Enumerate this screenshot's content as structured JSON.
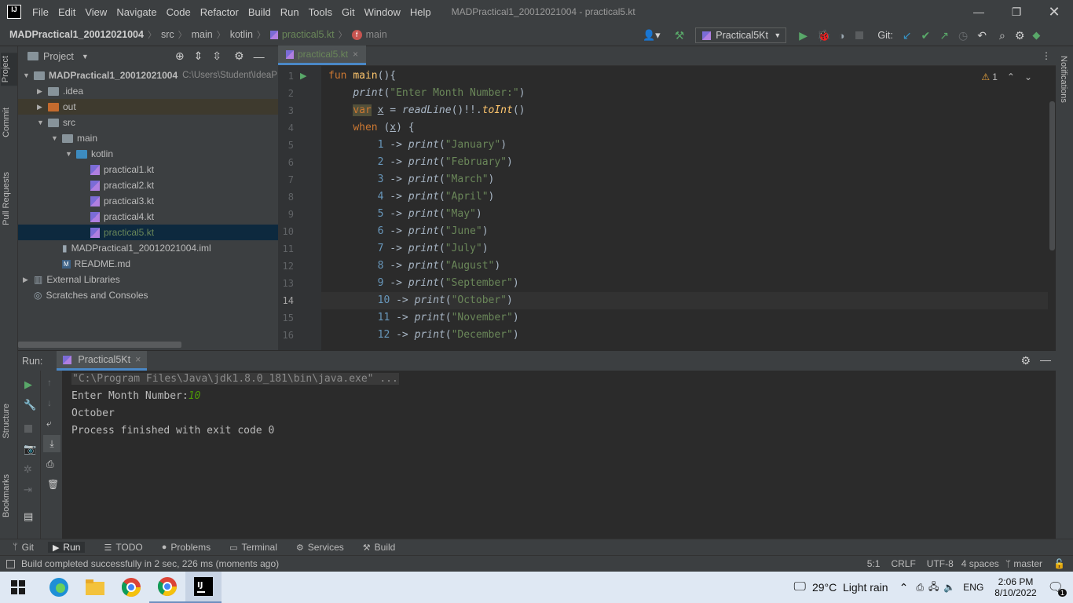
{
  "menubar": {
    "items": [
      "File",
      "Edit",
      "View",
      "Navigate",
      "Code",
      "Refactor",
      "Build",
      "Run",
      "Tools",
      "Git",
      "Window",
      "Help"
    ],
    "title": "MADPractical1_20012021004 - practical5.kt"
  },
  "navbar": {
    "crumbs": [
      "MADPractical1_20012021004",
      "src",
      "main",
      "kotlin",
      "practical5.kt",
      "main"
    ],
    "run_config": "Practical5Kt",
    "git_label": "Git:"
  },
  "side_tabs": {
    "left_top": [
      "Project",
      "Commit",
      "Pull Requests"
    ],
    "left_bottom": [
      "Structure",
      "Bookmarks"
    ],
    "right": [
      "Notifications"
    ]
  },
  "project": {
    "header": "Project",
    "tree": [
      {
        "label": "MADPractical1_20012021004",
        "path": "C:\\Users\\Student\\IdeaP",
        "indent": 0,
        "icon": "folder",
        "arrow": "down"
      },
      {
        "label": ".idea",
        "indent": 1,
        "icon": "folder",
        "arrow": "right"
      },
      {
        "label": "out",
        "indent": 1,
        "icon": "folder-orange",
        "arrow": "right"
      },
      {
        "label": "src",
        "indent": 1,
        "icon": "folder",
        "arrow": "down"
      },
      {
        "label": "main",
        "indent": 2,
        "icon": "folder",
        "arrow": "down"
      },
      {
        "label": "kotlin",
        "indent": 3,
        "icon": "folder-blue",
        "arrow": "down"
      },
      {
        "label": "practical1.kt",
        "indent": 4,
        "icon": "kotlin-file"
      },
      {
        "label": "practical2.kt",
        "indent": 4,
        "icon": "kotlin-file"
      },
      {
        "label": "practical3.kt",
        "indent": 4,
        "icon": "kotlin-file"
      },
      {
        "label": "practical4.kt",
        "indent": 4,
        "icon": "kotlin-file"
      },
      {
        "label": "practical5.kt",
        "indent": 4,
        "icon": "kotlin-file",
        "selected": true
      },
      {
        "label": "MADPractical1_20012021004.iml",
        "indent": 2,
        "icon": "iml-file"
      },
      {
        "label": "README.md",
        "indent": 2,
        "icon": "md-file"
      },
      {
        "label": "External Libraries",
        "indent": 0,
        "icon": "library",
        "arrow": "right"
      },
      {
        "label": "Scratches and Consoles",
        "indent": 0,
        "icon": "scratch"
      }
    ]
  },
  "editor": {
    "tab": "practical5.kt",
    "warnings": "1",
    "lines": [
      {
        "n": "1",
        "code": "fun main(){"
      },
      {
        "n": "2",
        "code": "    print(\"Enter Month Number:\")"
      },
      {
        "n": "3",
        "code": "    var x = readLine()!!.toInt()"
      },
      {
        "n": "4",
        "code": "    when (x) {"
      },
      {
        "n": "5",
        "code": "        1 -> print(\"January\")"
      },
      {
        "n": "6",
        "code": "        2 -> print(\"February\")"
      },
      {
        "n": "7",
        "code": "        3 -> print(\"March\")"
      },
      {
        "n": "8",
        "code": "        4 -> print(\"April\")"
      },
      {
        "n": "9",
        "code": "        5 -> print(\"May\")"
      },
      {
        "n": "10",
        "code": "        6 -> print(\"June\")"
      },
      {
        "n": "11",
        "code": "        7 -> print(\"July\")"
      },
      {
        "n": "12",
        "code": "        8 -> print(\"August\")"
      },
      {
        "n": "13",
        "code": "        9 -> print(\"September\")"
      },
      {
        "n": "14",
        "code": "        10 -> print(\"October\")"
      },
      {
        "n": "15",
        "code": "        11 -> print(\"November\")"
      },
      {
        "n": "16",
        "code": "        12 -> print(\"December\")"
      }
    ]
  },
  "run": {
    "label": "Run:",
    "tab": "Practical5Kt",
    "console": [
      "\"C:\\Program Files\\Java\\jdk1.8.0_181\\bin\\java.exe\" ...",
      "Enter Month Number:",
      "October",
      "Process finished with exit code 0"
    ],
    "input_value": "10"
  },
  "bottom_tabs": [
    "Git",
    "Run",
    "TODO",
    "Problems",
    "Terminal",
    "Services",
    "Build"
  ],
  "status": {
    "message": "Build completed successfully in 2 sec, 226 ms (moments ago)",
    "position": "5:1",
    "line_sep": "CRLF",
    "encoding": "UTF-8",
    "indent": "4 spaces",
    "branch": "master"
  },
  "taskbar": {
    "weather": "29°C  Light rain",
    "lang": "ENG",
    "time": "2:06 PM",
    "date": "8/10/2022",
    "notif_count": "1"
  }
}
